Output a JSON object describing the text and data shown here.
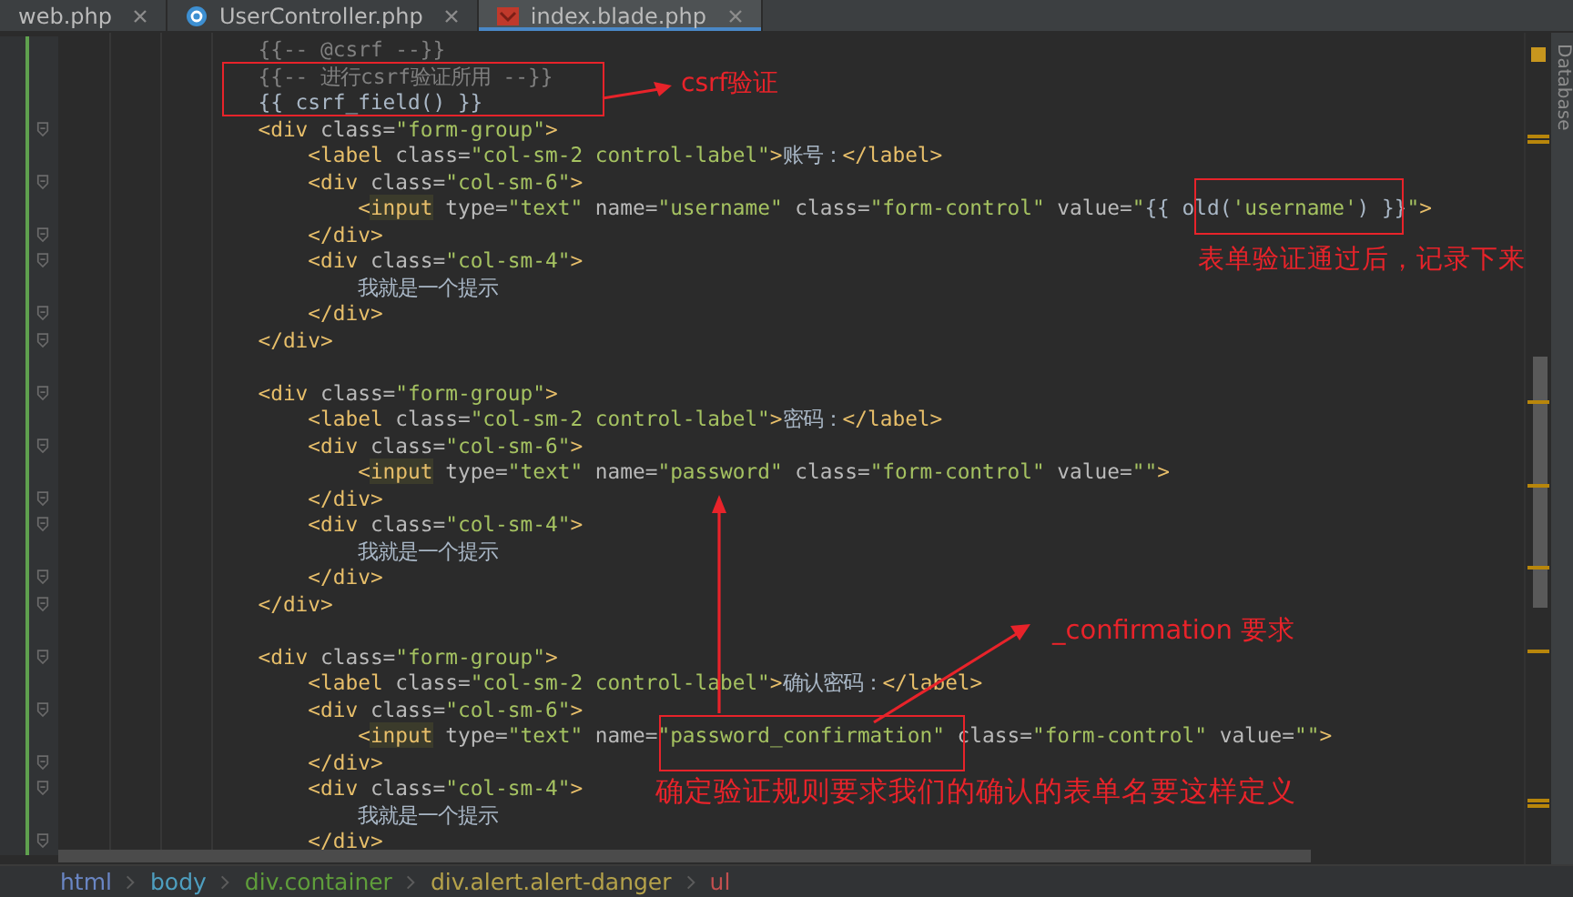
{
  "tabs": [
    {
      "label": "web.php",
      "kind": "php",
      "selected": false
    },
    {
      "label": "UserController.php",
      "kind": "class",
      "selected": false
    },
    {
      "label": "index.blade.php",
      "kind": "blade",
      "selected": true
    }
  ],
  "code_lines": [
    {
      "fold": false,
      "tokens": [
        {
          "kind": "comment",
          "text": "                {{-- @csrf --}}"
        }
      ]
    },
    {
      "fold": false,
      "tokens": [
        {
          "kind": "comment",
          "text": "                {{-- 进行csrf验证所用 --}}"
        }
      ]
    },
    {
      "fold": false,
      "tokens": [
        {
          "kind": "text",
          "text": "                {{ csrf_field() }}"
        }
      ]
    },
    {
      "fold": true,
      "tokens": [
        {
          "kind": "tag",
          "text": "                <div"
        },
        {
          "kind": "attr",
          "text": " class="
        },
        {
          "kind": "str",
          "text": "\"form-group\""
        },
        {
          "kind": "tag",
          "text": ">"
        }
      ]
    },
    {
      "fold": false,
      "tokens": [
        {
          "kind": "tag",
          "text": "                    <label"
        },
        {
          "kind": "attr",
          "text": " class="
        },
        {
          "kind": "str",
          "text": "\"col-sm-2 control-label\""
        },
        {
          "kind": "tag",
          "text": ">"
        },
        {
          "kind": "text",
          "text": "账号："
        },
        {
          "kind": "tag",
          "text": "</label>"
        }
      ]
    },
    {
      "fold": true,
      "tokens": [
        {
          "kind": "tag",
          "text": "                    <div"
        },
        {
          "kind": "attr",
          "text": " class="
        },
        {
          "kind": "str",
          "text": "\"col-sm-6\""
        },
        {
          "kind": "tag",
          "text": ">"
        }
      ]
    },
    {
      "fold": false,
      "tokens": [
        {
          "kind": "tag",
          "text": "                        <"
        },
        {
          "kind": "match",
          "text": "input"
        },
        {
          "kind": "attr",
          "text": " type="
        },
        {
          "kind": "str",
          "text": "\"text\""
        },
        {
          "kind": "attr",
          "text": " name="
        },
        {
          "kind": "str",
          "text": "\"username\""
        },
        {
          "kind": "attr",
          "text": " class="
        },
        {
          "kind": "str",
          "text": "\"form-control\""
        },
        {
          "kind": "attr",
          "text": " value="
        },
        {
          "kind": "str",
          "text": "\""
        },
        {
          "kind": "text",
          "text": "{{ old("
        },
        {
          "kind": "str",
          "text": "'username'"
        },
        {
          "kind": "text",
          "text": ") }}"
        },
        {
          "kind": "str",
          "text": "\""
        },
        {
          "kind": "tag",
          "text": ">"
        }
      ]
    },
    {
      "fold": true,
      "tokens": [
        {
          "kind": "tag",
          "text": "                    </div>"
        }
      ]
    },
    {
      "fold": true,
      "tokens": [
        {
          "kind": "tag",
          "text": "                    <div"
        },
        {
          "kind": "attr",
          "text": " class="
        },
        {
          "kind": "str",
          "text": "\"col-sm-4\""
        },
        {
          "kind": "tag",
          "text": ">"
        }
      ]
    },
    {
      "fold": false,
      "tokens": [
        {
          "kind": "text",
          "text": "                        我就是一个提示"
        }
      ]
    },
    {
      "fold": true,
      "tokens": [
        {
          "kind": "tag",
          "text": "                    </div>"
        }
      ]
    },
    {
      "fold": true,
      "tokens": [
        {
          "kind": "tag",
          "text": "                </div>"
        }
      ]
    },
    {
      "fold": false
    },
    {
      "fold": true,
      "tokens": [
        {
          "kind": "tag",
          "text": "                <div"
        },
        {
          "kind": "attr",
          "text": " class="
        },
        {
          "kind": "str",
          "text": "\"form-group\""
        },
        {
          "kind": "tag",
          "text": ">"
        }
      ]
    },
    {
      "fold": false,
      "tokens": [
        {
          "kind": "tag",
          "text": "                    <label"
        },
        {
          "kind": "attr",
          "text": " class="
        },
        {
          "kind": "str",
          "text": "\"col-sm-2 control-label\""
        },
        {
          "kind": "tag",
          "text": ">"
        },
        {
          "kind": "text",
          "text": "密码："
        },
        {
          "kind": "tag",
          "text": "</label>"
        }
      ]
    },
    {
      "fold": true,
      "tokens": [
        {
          "kind": "tag",
          "text": "                    <div"
        },
        {
          "kind": "attr",
          "text": " class="
        },
        {
          "kind": "str",
          "text": "\"col-sm-6\""
        },
        {
          "kind": "tag",
          "text": ">"
        }
      ]
    },
    {
      "fold": false,
      "tokens": [
        {
          "kind": "tag",
          "text": "                        <"
        },
        {
          "kind": "match",
          "text": "input"
        },
        {
          "kind": "attr",
          "text": " type="
        },
        {
          "kind": "str",
          "text": "\"text\""
        },
        {
          "kind": "attr",
          "text": " name="
        },
        {
          "kind": "str",
          "text": "\"password\""
        },
        {
          "kind": "attr",
          "text": " class="
        },
        {
          "kind": "str",
          "text": "\"form-control\""
        },
        {
          "kind": "attr",
          "text": " value="
        },
        {
          "kind": "str",
          "text": "\"\""
        },
        {
          "kind": "tag",
          "text": ">"
        }
      ]
    },
    {
      "fold": true,
      "tokens": [
        {
          "kind": "tag",
          "text": "                    </div>"
        }
      ]
    },
    {
      "fold": true,
      "tokens": [
        {
          "kind": "tag",
          "text": "                    <div"
        },
        {
          "kind": "attr",
          "text": " class="
        },
        {
          "kind": "str",
          "text": "\"col-sm-4\""
        },
        {
          "kind": "tag",
          "text": ">"
        }
      ]
    },
    {
      "fold": false,
      "tokens": [
        {
          "kind": "text",
          "text": "                        我就是一个提示"
        }
      ]
    },
    {
      "fold": true,
      "tokens": [
        {
          "kind": "tag",
          "text": "                    </div>"
        }
      ]
    },
    {
      "fold": true,
      "tokens": [
        {
          "kind": "tag",
          "text": "                </div>"
        }
      ]
    },
    {
      "fold": false
    },
    {
      "fold": true,
      "tokens": [
        {
          "kind": "tag",
          "text": "                <div"
        },
        {
          "kind": "attr",
          "text": " class="
        },
        {
          "kind": "str",
          "text": "\"form-group\""
        },
        {
          "kind": "tag",
          "text": ">"
        }
      ]
    },
    {
      "fold": false,
      "tokens": [
        {
          "kind": "tag",
          "text": "                    <label"
        },
        {
          "kind": "attr",
          "text": " class="
        },
        {
          "kind": "str",
          "text": "\"col-sm-2 control-label\""
        },
        {
          "kind": "tag",
          "text": ">"
        },
        {
          "kind": "text",
          "text": "确认密码："
        },
        {
          "kind": "tag",
          "text": "</label>"
        }
      ]
    },
    {
      "fold": true,
      "tokens": [
        {
          "kind": "tag",
          "text": "                    <div"
        },
        {
          "kind": "attr",
          "text": " class="
        },
        {
          "kind": "str",
          "text": "\"col-sm-6\""
        },
        {
          "kind": "tag",
          "text": ">"
        }
      ]
    },
    {
      "fold": false,
      "tokens": [
        {
          "kind": "tag",
          "text": "                        <"
        },
        {
          "kind": "match",
          "text": "input"
        },
        {
          "kind": "attr",
          "text": " type="
        },
        {
          "kind": "str",
          "text": "\"text\""
        },
        {
          "kind": "attr",
          "text": " name="
        },
        {
          "kind": "str",
          "text": "\"password_confirmation\""
        },
        {
          "kind": "attr",
          "text": " class="
        },
        {
          "kind": "str",
          "text": "\"form-control\""
        },
        {
          "kind": "attr",
          "text": " value="
        },
        {
          "kind": "str",
          "text": "\"\""
        },
        {
          "kind": "tag",
          "text": ">"
        }
      ]
    },
    {
      "fold": true,
      "tokens": [
        {
          "kind": "tag",
          "text": "                    </div>"
        }
      ]
    },
    {
      "fold": true,
      "tokens": [
        {
          "kind": "tag",
          "text": "                    <div"
        },
        {
          "kind": "attr",
          "text": " class="
        },
        {
          "kind": "str",
          "text": "\"col-sm-4\""
        },
        {
          "kind": "tag",
          "text": ">"
        }
      ]
    },
    {
      "fold": false,
      "tokens": [
        {
          "kind": "text",
          "text": "                        我就是一个提示"
        }
      ]
    },
    {
      "fold": true,
      "tokens": [
        {
          "kind": "tag",
          "text": "                    </div>"
        }
      ]
    }
  ],
  "annotations": [
    "csrf验证",
    "表单验证通过后，记录下来",
    "_confirmation 要求",
    "确定验证规则要求我们的确认的表单名要这样定义"
  ],
  "side_panel": {
    "label": "Database"
  },
  "breadcrumb": [
    {
      "label": "html",
      "color": "#6a86c4"
    },
    {
      "label": "body",
      "color": "#4e9fc0"
    },
    {
      "label": "div.container",
      "color": "#5f9e3b"
    },
    {
      "label": "div.alert.alert-danger",
      "color": "#b5a24a"
    },
    {
      "label": "ul",
      "color": "#c24f4f"
    }
  ]
}
